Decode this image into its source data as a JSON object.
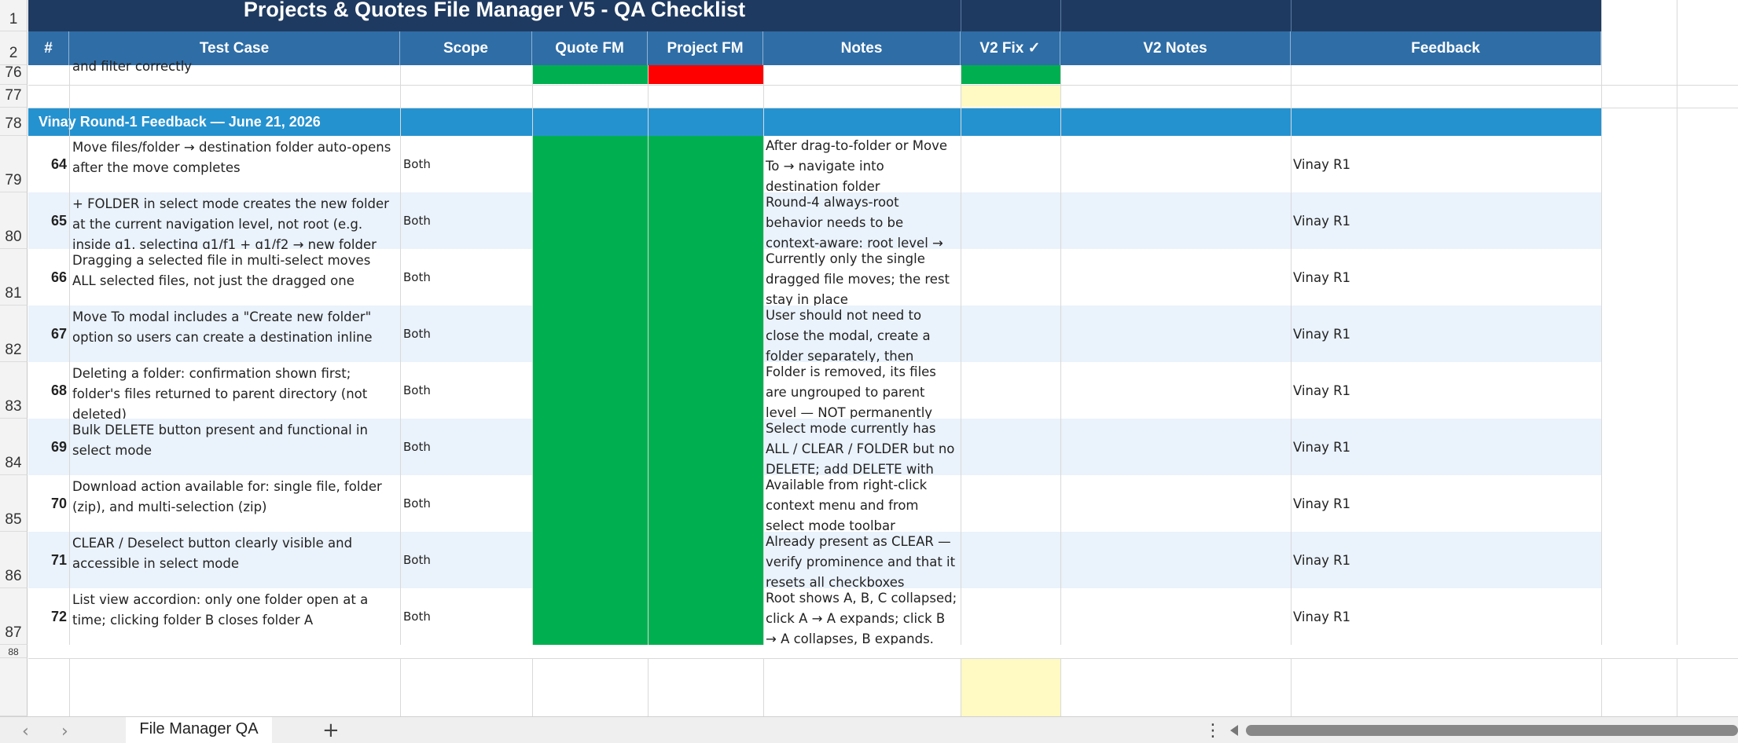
{
  "sheet": {
    "title": "Projects & Quotes File Manager V5 - QA Checklist",
    "headers": [
      "#",
      "Test Case",
      "Scope",
      "Quote FM",
      "Project FM",
      "Notes",
      "V2 Fix ✓",
      "V2 Notes",
      "Feedback"
    ],
    "row_numbers": [
      "1",
      "2",
      "76",
      "77",
      "78",
      "79",
      "80",
      "81",
      "82",
      "83",
      "84",
      "85",
      "86",
      "87",
      "88"
    ],
    "row76_text": "and filter correctly",
    "section_title": "Vinay Round-1 Feedback — June 21, 2026",
    "rows": [
      {
        "num": "64",
        "test": "Move files/folder → destination folder auto-opens after the move completes",
        "scope": "Both",
        "notes": "After drag-to-folder or Move To → navigate into destination folder",
        "feedback": "Vinay R1"
      },
      {
        "num": "65",
        "test": "+ FOLDER in select mode creates the new folder at the current navigation level, not root (e.g. inside g1, selecting g1/f1 + g1/f2 → new folder",
        "scope": "Both",
        "notes": "Round-4 always-root behavior needs to be context-aware: root level →",
        "feedback": "Vinay R1"
      },
      {
        "num": "66",
        "test": "Dragging a selected file in multi-select moves ALL selected files, not just the dragged one",
        "scope": "Both",
        "notes": "Currently only the single dragged file moves; the rest stay in place",
        "feedback": "Vinay R1"
      },
      {
        "num": "67",
        "test": "Move To modal includes a \"Create new folder\" option so users can create a destination inline",
        "scope": "Both",
        "notes": "User should not need to close the modal, create a folder separately, then",
        "feedback": "Vinay R1"
      },
      {
        "num": "68",
        "test": "Deleting a folder: confirmation shown first; folder's files returned to parent directory (not deleted)",
        "scope": "Both",
        "notes": "Folder is removed, its files are ungrouped to parent level — NOT permanently",
        "feedback": "Vinay R1"
      },
      {
        "num": "69",
        "test": "Bulk DELETE button present and functional in select mode",
        "scope": "Both",
        "notes": "Select mode currently has ALL / CLEAR / FOLDER but no DELETE; add DELETE with",
        "feedback": "Vinay R1"
      },
      {
        "num": "70",
        "test": "Download action available for: single file, folder (zip), and multi-selection (zip)",
        "scope": "Both",
        "notes": "Available from right-click context menu and from select mode toolbar",
        "feedback": "Vinay R1"
      },
      {
        "num": "71",
        "test": "CLEAR / Deselect button clearly visible and accessible in select mode",
        "scope": "Both",
        "notes": "Already present as CLEAR — verify prominence and that it resets all checkboxes",
        "feedback": "Vinay R1"
      },
      {
        "num": "72",
        "test": "List view accordion: only one folder open at a time; clicking folder B closes folder A",
        "scope": "Both",
        "notes": "Root shows A, B, C collapsed; click A → A expands; click B → A collapses, B expands.",
        "feedback": "Vinay R1"
      }
    ],
    "colors": {
      "title_band": "#1f3a60",
      "header": "#2f6da6",
      "section": "#2592d0",
      "pass": "#00b050",
      "fail": "#ff0000",
      "pending": "#fff9c4",
      "alt_row": "#eaf2fb"
    }
  },
  "tabs": {
    "active_sheet": "File Manager QA",
    "add_label": "+",
    "more_label": "⋮",
    "prev_label": "‹",
    "next_label": "›"
  }
}
